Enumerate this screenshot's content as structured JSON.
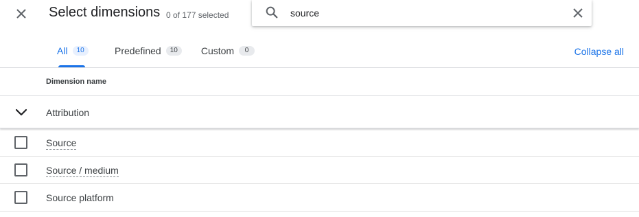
{
  "header": {
    "title": "Select dimensions",
    "selected_count": "0 of 177 selected"
  },
  "search": {
    "value": "source",
    "icon": "search-icon",
    "clear_icon": "close-icon"
  },
  "tabs": [
    {
      "label": "All",
      "count": "10",
      "active": true
    },
    {
      "label": "Predefined",
      "count": "10",
      "active": false
    },
    {
      "label": "Custom",
      "count": "0",
      "active": false
    }
  ],
  "collapse_all_label": "Collapse all",
  "table": {
    "column_header": "Dimension name",
    "group": {
      "label": "Attribution",
      "expanded": true
    },
    "rows": [
      {
        "label": "Source",
        "checked": false
      },
      {
        "label": "Source / medium",
        "checked": false
      },
      {
        "label": "Source platform",
        "checked": false
      }
    ]
  },
  "colors": {
    "accent": "#1a73e8",
    "text": "#202124",
    "secondary_text": "#5f6368",
    "divider": "#dadce0"
  }
}
